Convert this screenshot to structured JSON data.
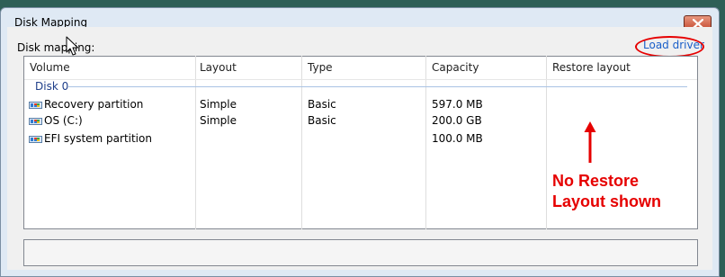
{
  "window": {
    "title": "Disk Mapping"
  },
  "disk_mapping_label": "Disk mapping:",
  "load_driver_label": "Load driver",
  "table": {
    "columns": [
      "Volume",
      "Layout",
      "Type",
      "Capacity",
      "Restore layout"
    ],
    "group": "Disk 0",
    "rows": [
      {
        "volume": "Recovery partition",
        "layout": "Simple",
        "type": "Basic",
        "capacity": "597.0 MB",
        "restore": ""
      },
      {
        "volume": "OS (C:)",
        "layout": "Simple",
        "type": "Basic",
        "capacity": "200.0 GB",
        "restore": ""
      },
      {
        "volume": "EFI system partition",
        "layout": "",
        "type": "",
        "capacity": "100.0 MB",
        "restore": ""
      }
    ]
  },
  "annotation": {
    "line1": "No Restore",
    "line2": "Layout shown"
  },
  "colors": {
    "annotation": "#e60000",
    "link": "#1a5fc9",
    "group": "#1e3e8a"
  },
  "icons": [
    "close-icon",
    "volume-icon",
    "mouse-cursor-icon",
    "arrow-up-icon"
  ]
}
